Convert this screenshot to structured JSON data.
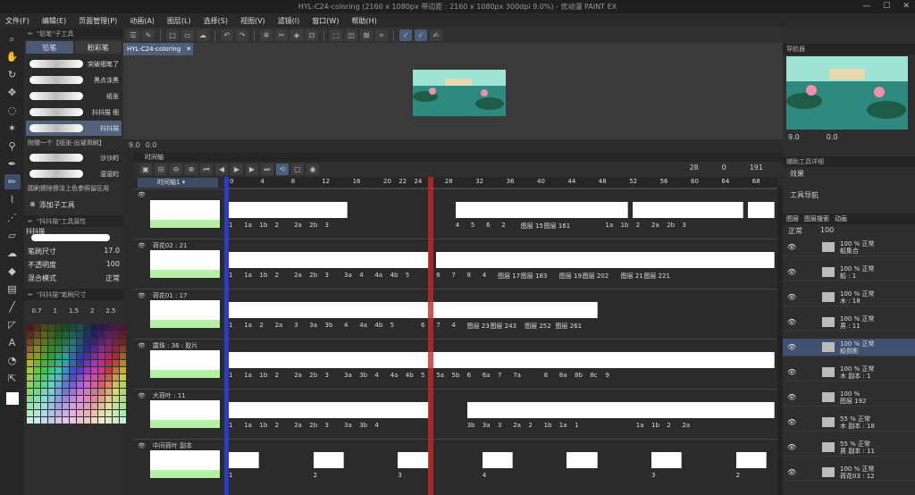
{
  "title": "HYL-C24-coloring (2160 x 1080px 带边距 : 2160 x 1080px 300dpi 9.0%) - 优动漫 PAINT EX",
  "menu": [
    "文件(F)",
    "编辑(E)",
    "页面管理(P)",
    "动画(A)",
    "图层(L)",
    "选择(S)",
    "视图(V)",
    "滤镜(I)",
    "窗口(W)",
    "帮助(H)"
  ],
  "doc_tab": "HYL-C24-coloring",
  "left": {
    "tabs": [
      "铅笔",
      "粉彩笔"
    ],
    "header": "\"铅笔\"子工具",
    "brushes": [
      {
        "name": "突破细笔了"
      },
      {
        "name": "黑点涂黑"
      },
      {
        "name": "纸张"
      },
      {
        "name": "抖抖描 细"
      },
      {
        "name": "抖抖描"
      }
    ],
    "brush_desc": "附赠一个【纸张-出凝滑刷】",
    "brushes2": [
      {
        "name": "沙沙的"
      },
      {
        "name": "湿湿的"
      }
    ],
    "brush_note": "圆刷擦除擦涂上色参照留区用",
    "add_tool": "添加子工具",
    "prop_header": "\"抖抖描\"工具属性",
    "prop_brush": "抖抖描",
    "props": [
      {
        "label": "笔刷尺寸",
        "value": "17.0"
      },
      {
        "label": "不透明度",
        "value": "100"
      },
      {
        "label": "混合模式",
        "value": "正常"
      }
    ],
    "size_header": "\"抖抖描\"笔刷尺寸",
    "sizes": [
      "0.7",
      "1",
      "1.5",
      "2",
      "2.5"
    ]
  },
  "canvas": {
    "zoom": "9.0",
    "angle": "0.0"
  },
  "timeline": {
    "header": "时间轴",
    "name": "时间轴1",
    "counter": [
      "28",
      "0",
      "191"
    ],
    "ruler": [
      {
        "label": "0",
        "f": 0
      },
      {
        "label": "4",
        "f": 4
      },
      {
        "label": "8",
        "f": 8
      },
      {
        "label": "12",
        "f": 12
      },
      {
        "label": "16",
        "f": 16
      },
      {
        "label": "20",
        "f": 20
      },
      {
        "label": "22",
        "f": 22
      },
      {
        "label": "24",
        "f": 24
      },
      {
        "label": "28",
        "f": 28
      },
      {
        "label": "32",
        "f": 32
      },
      {
        "label": "36",
        "f": 36
      },
      {
        "label": "40",
        "f": 40
      },
      {
        "label": "44",
        "f": 44
      },
      {
        "label": "48",
        "f": 48
      },
      {
        "label": "52",
        "f": 52
      },
      {
        "label": "56",
        "f": 56
      },
      {
        "label": "60",
        "f": 60
      },
      {
        "label": "64",
        "f": 64
      },
      {
        "label": "68",
        "f": 68
      },
      {
        "label": "72",
        "f": 72
      }
    ],
    "tracks": [
      {
        "label": "",
        "cells": [
          [
            0,
            15.5
          ],
          [
            29.5,
            52
          ],
          [
            52.5,
            67
          ],
          [
            67.5,
            71
          ]
        ],
        "nums": [
          {
            "t": "1",
            "f": 0
          },
          {
            "t": "1a",
            "f": 2
          },
          {
            "t": "1b",
            "f": 4
          },
          {
            "t": "2",
            "f": 6
          },
          {
            "t": "2a",
            "f": 8.5
          },
          {
            "t": "2b",
            "f": 10.5
          },
          {
            "t": "3",
            "f": 12.5
          },
          {
            "t": "4",
            "f": 29.5
          },
          {
            "t": "5",
            "f": 31.5
          },
          {
            "t": "6",
            "f": 33.5
          },
          {
            "t": "2",
            "f": 35.5
          },
          {
            "t": "图层 15",
            "f": 38
          },
          {
            "t": "图层 161",
            "f": 41
          },
          {
            "t": "1a",
            "f": 49
          },
          {
            "t": "1b",
            "f": 51
          },
          {
            "t": "2",
            "f": 53
          },
          {
            "t": "2a",
            "f": 55
          },
          {
            "t": "2b",
            "f": 57
          },
          {
            "t": "3",
            "f": 59
          }
        ]
      },
      {
        "label": "荷花02 : 21",
        "cells": [
          [
            0,
            26
          ],
          [
            27,
            71
          ]
        ],
        "nums": [
          {
            "t": "1",
            "f": 0
          },
          {
            "t": "1a",
            "f": 2
          },
          {
            "t": "1b",
            "f": 4
          },
          {
            "t": "2",
            "f": 6
          },
          {
            "t": "2a",
            "f": 8.5
          },
          {
            "t": "2b",
            "f": 10.5
          },
          {
            "t": "3",
            "f": 12.5
          },
          {
            "t": "3a",
            "f": 15
          },
          {
            "t": "4",
            "f": 17
          },
          {
            "t": "4a",
            "f": 19
          },
          {
            "t": "4b",
            "f": 21
          },
          {
            "t": "5",
            "f": 23
          },
          {
            "t": "6",
            "f": 27
          },
          {
            "t": "7",
            "f": 29
          },
          {
            "t": "8",
            "f": 31
          },
          {
            "t": "4",
            "f": 33
          },
          {
            "t": "图层 17",
            "f": 35
          },
          {
            "t": "图层 183",
            "f": 38
          },
          {
            "t": "图层 19",
            "f": 43
          },
          {
            "t": "图层 202",
            "f": 46
          },
          {
            "t": "图层 21",
            "f": 51
          },
          {
            "t": "图层 221",
            "f": 54
          }
        ]
      },
      {
        "label": "荷花01 : 17",
        "cells": [
          [
            0,
            48
          ]
        ],
        "nums": [
          {
            "t": "1",
            "f": 0
          },
          {
            "t": "1a",
            "f": 2
          },
          {
            "t": "2",
            "f": 4
          },
          {
            "t": "2a",
            "f": 6
          },
          {
            "t": "3",
            "f": 8.5
          },
          {
            "t": "3a",
            "f": 10.5
          },
          {
            "t": "3b",
            "f": 12.5
          },
          {
            "t": "4",
            "f": 15
          },
          {
            "t": "4a",
            "f": 17
          },
          {
            "t": "4b",
            "f": 19
          },
          {
            "t": "5",
            "f": 21
          },
          {
            "t": "6",
            "f": 25
          },
          {
            "t": "7",
            "f": 27
          },
          {
            "t": "4",
            "f": 29
          },
          {
            "t": "图层 23",
            "f": 31
          },
          {
            "t": "图层 243",
            "f": 34
          },
          {
            "t": "图层 252",
            "f": 38.5
          },
          {
            "t": "图层 261",
            "f": 42.5
          }
        ]
      },
      {
        "label": "露珠 : 36 : 胶片",
        "cells": [
          [
            0,
            71
          ]
        ],
        "nums": [
          {
            "t": "1",
            "f": 0
          },
          {
            "t": "1a",
            "f": 2
          },
          {
            "t": "1b",
            "f": 4
          },
          {
            "t": "2",
            "f": 6
          },
          {
            "t": "2a",
            "f": 8.5
          },
          {
            "t": "2b",
            "f": 10.5
          },
          {
            "t": "3",
            "f": 12.5
          },
          {
            "t": "3a",
            "f": 15
          },
          {
            "t": "3b",
            "f": 17
          },
          {
            "t": "4",
            "f": 19
          },
          {
            "t": "4a",
            "f": 21
          },
          {
            "t": "4b",
            "f": 23
          },
          {
            "t": "5",
            "f": 25
          },
          {
            "t": "5a",
            "f": 27
          },
          {
            "t": "5b",
            "f": 29
          },
          {
            "t": "6",
            "f": 31
          },
          {
            "t": "6a",
            "f": 33
          },
          {
            "t": "7",
            "f": 35
          },
          {
            "t": "7a",
            "f": 37
          },
          {
            "t": "8",
            "f": 41
          },
          {
            "t": "8a",
            "f": 43
          },
          {
            "t": "8b",
            "f": 45
          },
          {
            "t": "8c",
            "f": 47
          },
          {
            "t": "9",
            "f": 49
          }
        ]
      },
      {
        "label": "大荷叶 : 11",
        "cells": [
          [
            0,
            26
          ],
          [
            31,
            71
          ]
        ],
        "nums": [
          {
            "t": "1",
            "f": 0
          },
          {
            "t": "1a",
            "f": 2
          },
          {
            "t": "1b",
            "f": 4
          },
          {
            "t": "2",
            "f": 6
          },
          {
            "t": "2a",
            "f": 8.5
          },
          {
            "t": "2b",
            "f": 10.5
          },
          {
            "t": "3",
            "f": 12.5
          },
          {
            "t": "3a",
            "f": 15
          },
          {
            "t": "3b",
            "f": 17
          },
          {
            "t": "4",
            "f": 19
          },
          {
            "t": "3b",
            "f": 31
          },
          {
            "t": "3a",
            "f": 33
          },
          {
            "t": "3",
            "f": 35
          },
          {
            "t": "2a",
            "f": 37
          },
          {
            "t": "2",
            "f": 39
          },
          {
            "t": "1b",
            "f": 41
          },
          {
            "t": "1a",
            "f": 43
          },
          {
            "t": "1",
            "f": 45
          },
          {
            "t": "1a",
            "f": 53
          },
          {
            "t": "1b",
            "f": 55
          },
          {
            "t": "2",
            "f": 57
          },
          {
            "t": "2a",
            "f": 59
          }
        ]
      },
      {
        "label": "中间荷叶 副本",
        "cells": [
          [
            0,
            4
          ],
          [
            11,
            15
          ],
          [
            22,
            26
          ],
          [
            33,
            37
          ],
          [
            44,
            48
          ],
          [
            55,
            59
          ],
          [
            66,
            70
          ]
        ],
        "nums": [
          {
            "t": "1",
            "f": 0
          },
          {
            "t": "2",
            "f": 11
          },
          {
            "t": "3",
            "f": 22
          },
          {
            "t": "4",
            "f": 33
          },
          {
            "t": "3",
            "f": 55
          },
          {
            "t": "2",
            "f": 66
          }
        ]
      }
    ]
  },
  "right": {
    "nav_title": "导航器",
    "zoom": "9.0",
    "angle": "0.0",
    "tool_prop": "辅助工具详细",
    "effect": "效果",
    "tool_nav": "工具导航",
    "layer_tabs": [
      "图层",
      "图层搜索",
      "动画"
    ],
    "blend": "正常",
    "opacity": "100",
    "layers": [
      {
        "t": "100 % 正常\n船集合"
      },
      {
        "t": "100 % 正常\n船 : 1"
      },
      {
        "t": "100 % 正常\n木 : 18"
      },
      {
        "t": "100 % 正常\n男 : 11"
      },
      {
        "t": "100 % 正常\n船倒影",
        "sel": true
      },
      {
        "t": "100 % 正常\n木 副本 : 1"
      },
      {
        "t": "100 %\n图层 192"
      },
      {
        "t": "55 % 正常\n木 副本 : 18"
      },
      {
        "t": "55 % 正常\n男 副本 : 11"
      },
      {
        "t": "100 % 正常\n荷花03 : 12"
      }
    ]
  }
}
